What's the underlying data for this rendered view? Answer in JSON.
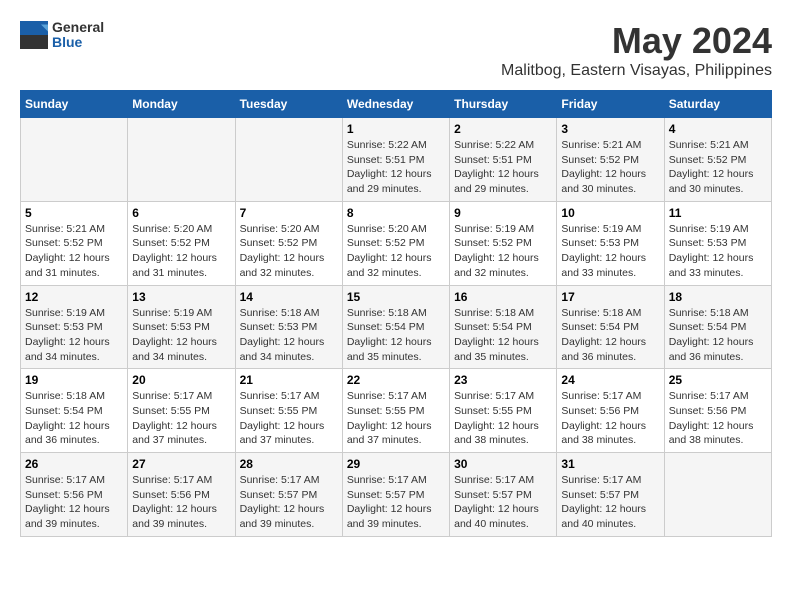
{
  "logo": {
    "general": "General",
    "blue": "Blue"
  },
  "title": "May 2024",
  "subtitle": "Malitbog, Eastern Visayas, Philippines",
  "weekdays": [
    "Sunday",
    "Monday",
    "Tuesday",
    "Wednesday",
    "Thursday",
    "Friday",
    "Saturday"
  ],
  "weeks": [
    [
      {
        "day": "",
        "sunrise": "",
        "sunset": "",
        "daylight": ""
      },
      {
        "day": "",
        "sunrise": "",
        "sunset": "",
        "daylight": ""
      },
      {
        "day": "",
        "sunrise": "",
        "sunset": "",
        "daylight": ""
      },
      {
        "day": "1",
        "sunrise": "Sunrise: 5:22 AM",
        "sunset": "Sunset: 5:51 PM",
        "daylight": "Daylight: 12 hours and 29 minutes."
      },
      {
        "day": "2",
        "sunrise": "Sunrise: 5:22 AM",
        "sunset": "Sunset: 5:51 PM",
        "daylight": "Daylight: 12 hours and 29 minutes."
      },
      {
        "day": "3",
        "sunrise": "Sunrise: 5:21 AM",
        "sunset": "Sunset: 5:52 PM",
        "daylight": "Daylight: 12 hours and 30 minutes."
      },
      {
        "day": "4",
        "sunrise": "Sunrise: 5:21 AM",
        "sunset": "Sunset: 5:52 PM",
        "daylight": "Daylight: 12 hours and 30 minutes."
      }
    ],
    [
      {
        "day": "5",
        "sunrise": "Sunrise: 5:21 AM",
        "sunset": "Sunset: 5:52 PM",
        "daylight": "Daylight: 12 hours and 31 minutes."
      },
      {
        "day": "6",
        "sunrise": "Sunrise: 5:20 AM",
        "sunset": "Sunset: 5:52 PM",
        "daylight": "Daylight: 12 hours and 31 minutes."
      },
      {
        "day": "7",
        "sunrise": "Sunrise: 5:20 AM",
        "sunset": "Sunset: 5:52 PM",
        "daylight": "Daylight: 12 hours and 32 minutes."
      },
      {
        "day": "8",
        "sunrise": "Sunrise: 5:20 AM",
        "sunset": "Sunset: 5:52 PM",
        "daylight": "Daylight: 12 hours and 32 minutes."
      },
      {
        "day": "9",
        "sunrise": "Sunrise: 5:19 AM",
        "sunset": "Sunset: 5:52 PM",
        "daylight": "Daylight: 12 hours and 32 minutes."
      },
      {
        "day": "10",
        "sunrise": "Sunrise: 5:19 AM",
        "sunset": "Sunset: 5:53 PM",
        "daylight": "Daylight: 12 hours and 33 minutes."
      },
      {
        "day": "11",
        "sunrise": "Sunrise: 5:19 AM",
        "sunset": "Sunset: 5:53 PM",
        "daylight": "Daylight: 12 hours and 33 minutes."
      }
    ],
    [
      {
        "day": "12",
        "sunrise": "Sunrise: 5:19 AM",
        "sunset": "Sunset: 5:53 PM",
        "daylight": "Daylight: 12 hours and 34 minutes."
      },
      {
        "day": "13",
        "sunrise": "Sunrise: 5:19 AM",
        "sunset": "Sunset: 5:53 PM",
        "daylight": "Daylight: 12 hours and 34 minutes."
      },
      {
        "day": "14",
        "sunrise": "Sunrise: 5:18 AM",
        "sunset": "Sunset: 5:53 PM",
        "daylight": "Daylight: 12 hours and 34 minutes."
      },
      {
        "day": "15",
        "sunrise": "Sunrise: 5:18 AM",
        "sunset": "Sunset: 5:54 PM",
        "daylight": "Daylight: 12 hours and 35 minutes."
      },
      {
        "day": "16",
        "sunrise": "Sunrise: 5:18 AM",
        "sunset": "Sunset: 5:54 PM",
        "daylight": "Daylight: 12 hours and 35 minutes."
      },
      {
        "day": "17",
        "sunrise": "Sunrise: 5:18 AM",
        "sunset": "Sunset: 5:54 PM",
        "daylight": "Daylight: 12 hours and 36 minutes."
      },
      {
        "day": "18",
        "sunrise": "Sunrise: 5:18 AM",
        "sunset": "Sunset: 5:54 PM",
        "daylight": "Daylight: 12 hours and 36 minutes."
      }
    ],
    [
      {
        "day": "19",
        "sunrise": "Sunrise: 5:18 AM",
        "sunset": "Sunset: 5:54 PM",
        "daylight": "Daylight: 12 hours and 36 minutes."
      },
      {
        "day": "20",
        "sunrise": "Sunrise: 5:17 AM",
        "sunset": "Sunset: 5:55 PM",
        "daylight": "Daylight: 12 hours and 37 minutes."
      },
      {
        "day": "21",
        "sunrise": "Sunrise: 5:17 AM",
        "sunset": "Sunset: 5:55 PM",
        "daylight": "Daylight: 12 hours and 37 minutes."
      },
      {
        "day": "22",
        "sunrise": "Sunrise: 5:17 AM",
        "sunset": "Sunset: 5:55 PM",
        "daylight": "Daylight: 12 hours and 37 minutes."
      },
      {
        "day": "23",
        "sunrise": "Sunrise: 5:17 AM",
        "sunset": "Sunset: 5:55 PM",
        "daylight": "Daylight: 12 hours and 38 minutes."
      },
      {
        "day": "24",
        "sunrise": "Sunrise: 5:17 AM",
        "sunset": "Sunset: 5:56 PM",
        "daylight": "Daylight: 12 hours and 38 minutes."
      },
      {
        "day": "25",
        "sunrise": "Sunrise: 5:17 AM",
        "sunset": "Sunset: 5:56 PM",
        "daylight": "Daylight: 12 hours and 38 minutes."
      }
    ],
    [
      {
        "day": "26",
        "sunrise": "Sunrise: 5:17 AM",
        "sunset": "Sunset: 5:56 PM",
        "daylight": "Daylight: 12 hours and 39 minutes."
      },
      {
        "day": "27",
        "sunrise": "Sunrise: 5:17 AM",
        "sunset": "Sunset: 5:56 PM",
        "daylight": "Daylight: 12 hours and 39 minutes."
      },
      {
        "day": "28",
        "sunrise": "Sunrise: 5:17 AM",
        "sunset": "Sunset: 5:57 PM",
        "daylight": "Daylight: 12 hours and 39 minutes."
      },
      {
        "day": "29",
        "sunrise": "Sunrise: 5:17 AM",
        "sunset": "Sunset: 5:57 PM",
        "daylight": "Daylight: 12 hours and 39 minutes."
      },
      {
        "day": "30",
        "sunrise": "Sunrise: 5:17 AM",
        "sunset": "Sunset: 5:57 PM",
        "daylight": "Daylight: 12 hours and 40 minutes."
      },
      {
        "day": "31",
        "sunrise": "Sunrise: 5:17 AM",
        "sunset": "Sunset: 5:57 PM",
        "daylight": "Daylight: 12 hours and 40 minutes."
      },
      {
        "day": "",
        "sunrise": "",
        "sunset": "",
        "daylight": ""
      }
    ]
  ]
}
